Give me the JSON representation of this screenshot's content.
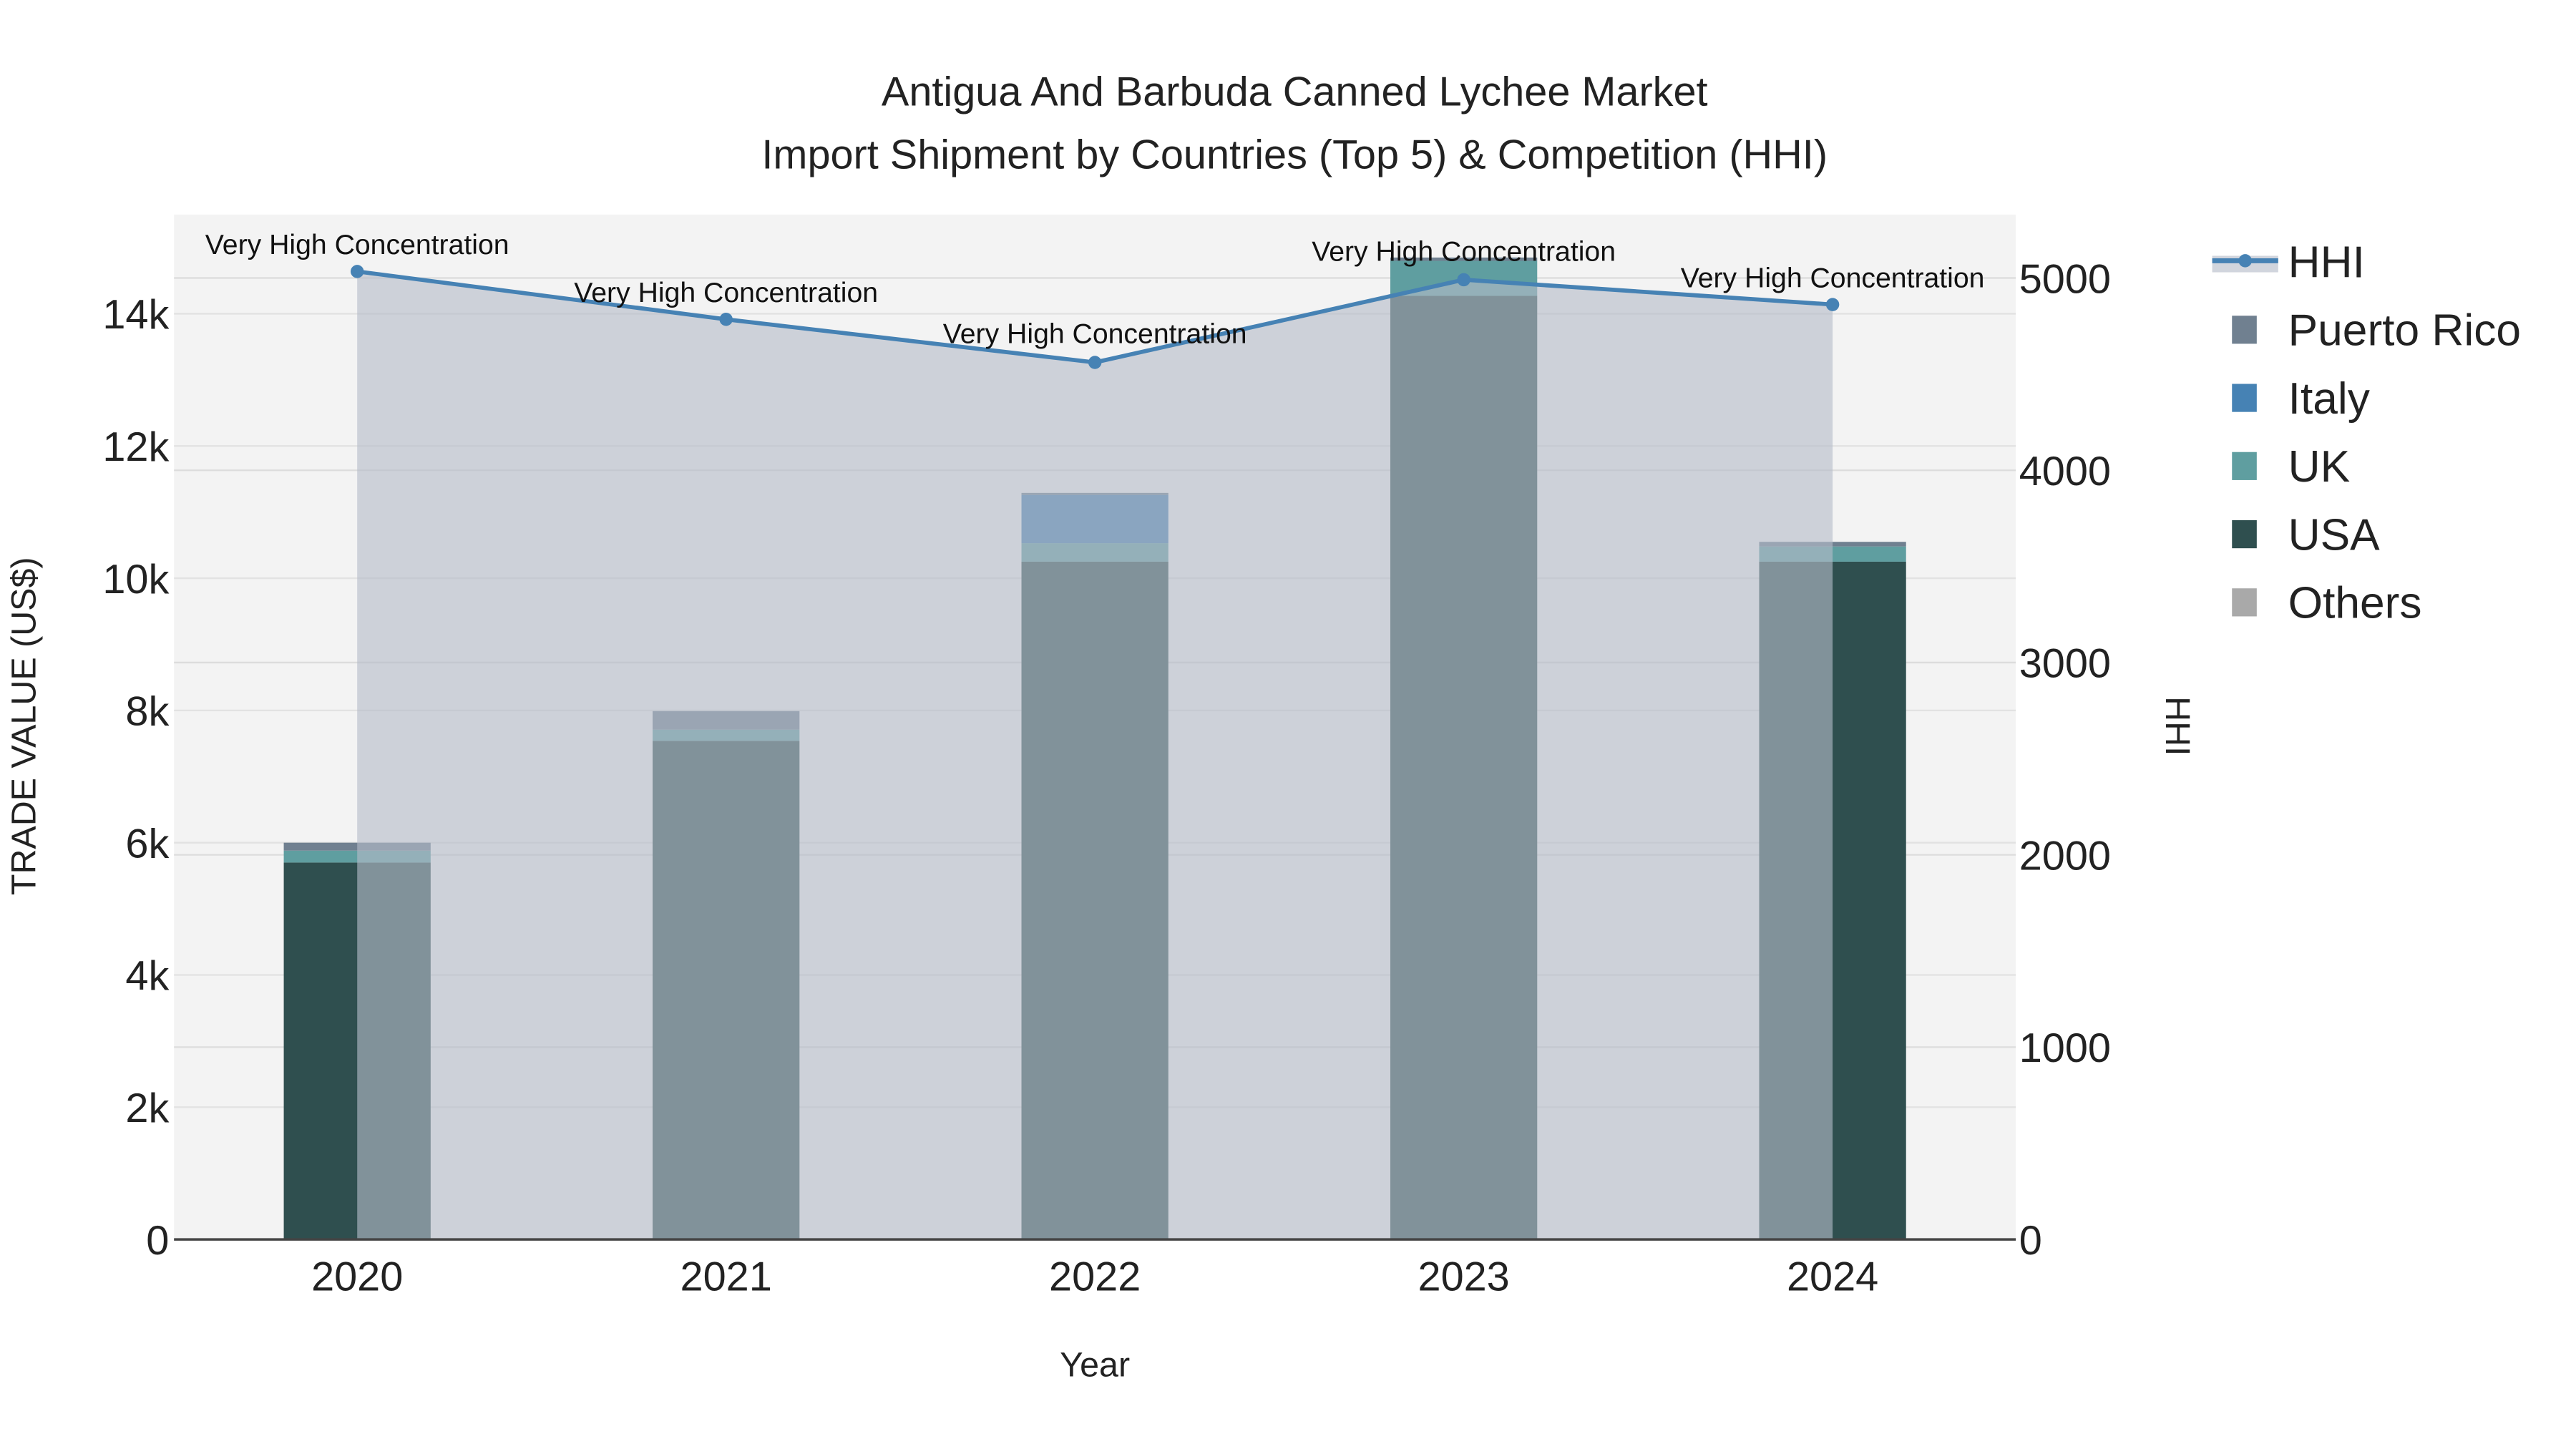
{
  "chart_data": {
    "type": "bar",
    "title": "Antigua And Barbuda Canned Lychee Market",
    "subtitle": "Import Shipment by Countries (Top 5) & Competition (HHI)",
    "xlabel": "Year",
    "ylabel": "TRADE VALUE (US$)",
    "y2label": "HHI",
    "categories": [
      "2020",
      "2021",
      "2022",
      "2023",
      "2024"
    ],
    "ylim": [
      0,
      15500
    ],
    "y2lim": [
      0,
      5330
    ],
    "yticks": [
      0,
      2000,
      4000,
      6000,
      8000,
      10000,
      12000,
      14000
    ],
    "ytick_labels": [
      "0",
      "2k",
      "4k",
      "6k",
      "8k",
      "10k",
      "12k",
      "14k"
    ],
    "y2ticks": [
      0,
      1000,
      2000,
      3000,
      4000,
      5000
    ],
    "y2tick_labels": [
      "0",
      "1000",
      "2000",
      "3000",
      "4000",
      "5000"
    ],
    "stacked": true,
    "series": [
      {
        "name": "USA",
        "color": "#2F4F4F",
        "values": [
          5700,
          7540,
          10250,
          14270,
          10250
        ]
      },
      {
        "name": "UK",
        "color": "#5F9EA0",
        "values": [
          180,
          170,
          280,
          530,
          230
        ]
      },
      {
        "name": "Italy",
        "color": "#4682B4",
        "values": [
          0,
          0,
          730,
          0,
          0
        ]
      },
      {
        "name": "Puerto Rico",
        "color": "#708090",
        "values": [
          120,
          280,
          30,
          50,
          70
        ]
      },
      {
        "name": "Others",
        "color": "#A9A9A9",
        "values": [
          0,
          0,
          0,
          0,
          0
        ]
      }
    ],
    "hhi": {
      "name": "HHI",
      "color": "#4682B4",
      "values": [
        5034,
        4785,
        4561,
        4991,
        4862
      ],
      "annotations": [
        "Very High Concentration",
        "Very High Concentration",
        "Very High Concentration",
        "Very High Concentration",
        "Very High Concentration"
      ]
    },
    "legend": [
      "HHI",
      "Puerto Rico",
      "Italy",
      "UK",
      "USA",
      "Others"
    ],
    "legend_position": "right",
    "grid": true
  }
}
